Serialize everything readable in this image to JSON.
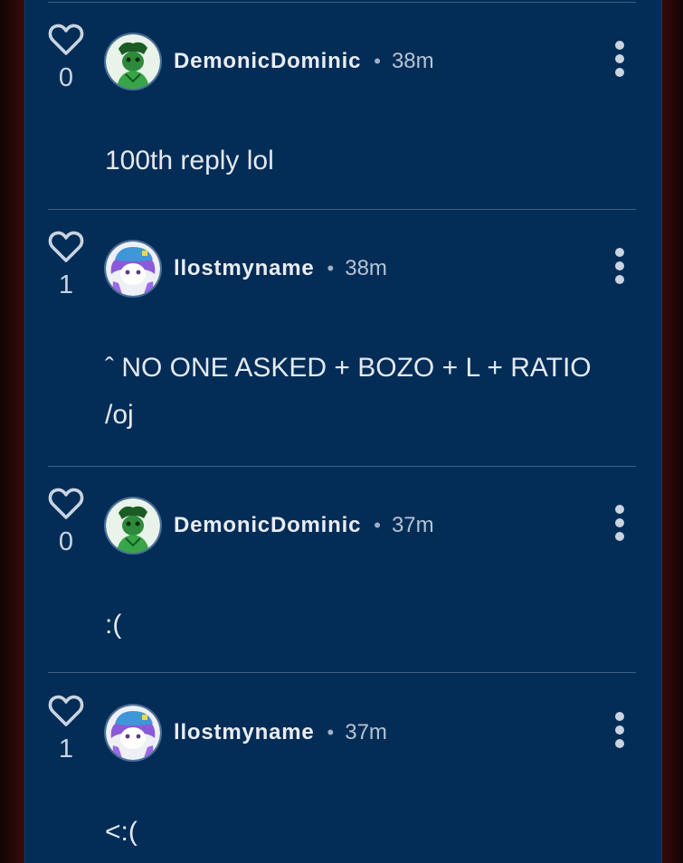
{
  "comments": [
    {
      "username": "DemonicDominic",
      "separator": "•",
      "time": "38m",
      "likes": "0",
      "text": "100th reply lol",
      "avatar": "green-character-avatar"
    },
    {
      "username": "llostmyname",
      "separator": "•",
      "time": "38m",
      "likes": "1",
      "text": "ˆ NO ONE ASKED + BOZO + L + RATIO\n/oj",
      "avatar": "purple-hair-blue-cap-avatar"
    },
    {
      "username": "DemonicDominic",
      "separator": "•",
      "time": "37m",
      "likes": "0",
      "text": ":(",
      "avatar": "green-character-avatar"
    },
    {
      "username": "llostmyname",
      "separator": "•",
      "time": "37m",
      "likes": "1",
      "text": "<:(",
      "avatar": "purple-hair-blue-cap-avatar"
    }
  ],
  "icons": {
    "like": "heart-icon",
    "menu": "more-vertical-icon"
  },
  "colors": {
    "panel_background": "#032c56",
    "divider": "#3d5f84",
    "text_primary": "#e9edf3",
    "text_secondary": "#b7c4d4",
    "outer_background": "#1a0606"
  }
}
